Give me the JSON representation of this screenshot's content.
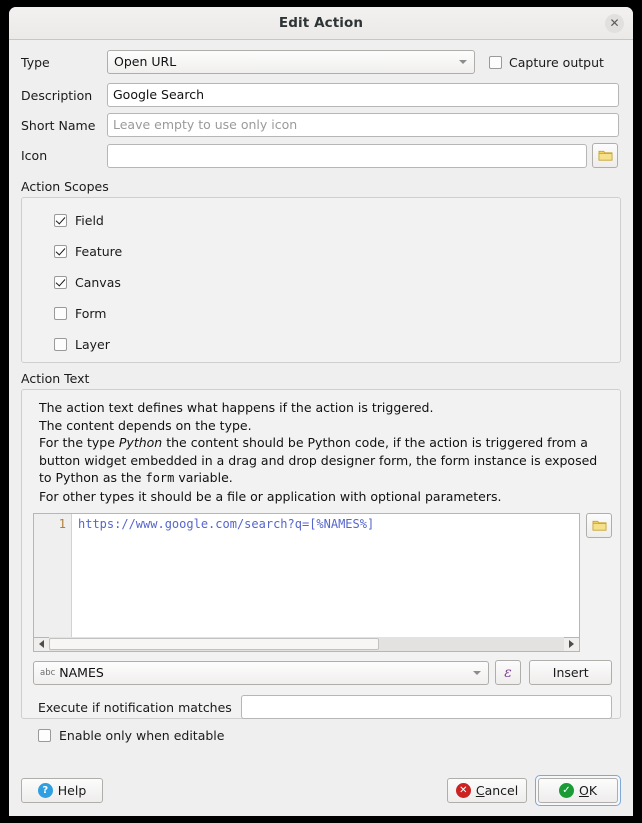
{
  "window": {
    "title": "Edit Action",
    "close_icon": "close-icon",
    "close_glyph": "✕"
  },
  "form": {
    "type_label": "Type",
    "type_value": "Open URL",
    "capture_output_label": "Capture output",
    "capture_output_checked": false,
    "description_label": "Description",
    "description_value": "Google Search",
    "short_name_label": "Short Name",
    "short_name_value": "",
    "short_name_placeholder": "Leave empty to use only icon",
    "icon_label": "Icon",
    "icon_value": "",
    "icon_browse_icon": "folder-icon"
  },
  "action_scopes": {
    "title": "Action Scopes",
    "items": [
      {
        "label": "Field",
        "checked": true
      },
      {
        "label": "Feature",
        "checked": true
      },
      {
        "label": "Canvas",
        "checked": true
      },
      {
        "label": "Form",
        "checked": false
      },
      {
        "label": "Layer",
        "checked": false
      }
    ]
  },
  "action_text": {
    "title": "Action Text",
    "help_line1": "The action text defines what happens if the action is triggered.",
    "help_line2": "The content depends on the type.",
    "help_line3_a": "For the type ",
    "help_line3_em": "Python",
    "help_line3_b": " the content should be Python code, if the action is triggered from a button widget embedded in a drag and drop designer form, the form instance is exposed to Python as the ",
    "help_line3_code": "form",
    "help_line3_c": " variable.",
    "help_line4": "For other types it should be a file or application with optional parameters.",
    "editor_line_number": "1",
    "editor_code": "https://www.google.com/search?q=[%NAMES%]",
    "editor_browse_icon": "folder-icon",
    "code_color": "#5566cc",
    "gutter_color": "#b07f3a"
  },
  "field_picker": {
    "type_badge": "abc",
    "selected_field": "NAMES",
    "expression_icon": "epsilon-icon",
    "expression_glyph": "ɛ",
    "insert_label": "Insert"
  },
  "notification": {
    "label": "Execute if notification matches",
    "value": ""
  },
  "editable": {
    "label": "Enable only when editable",
    "checked": false
  },
  "buttons": {
    "help": {
      "label": "Help",
      "icon": "help-icon",
      "glyph": "?"
    },
    "cancel": {
      "mnemonic": "C",
      "rest": "ancel",
      "icon": "cancel-icon",
      "glyph": "✕"
    },
    "ok": {
      "mnemonic": "O",
      "rest": "K",
      "icon": "ok-icon",
      "glyph": "✓",
      "focused": true
    }
  },
  "colors": {
    "dialog_bg": "#efefef",
    "accent_focus": "#7fa8d4",
    "green": "#1a9b35",
    "red": "#cc2222",
    "blue": "#2e9fe0",
    "purple": "#7a3f8c",
    "folder_yellow": "#f0d060"
  }
}
